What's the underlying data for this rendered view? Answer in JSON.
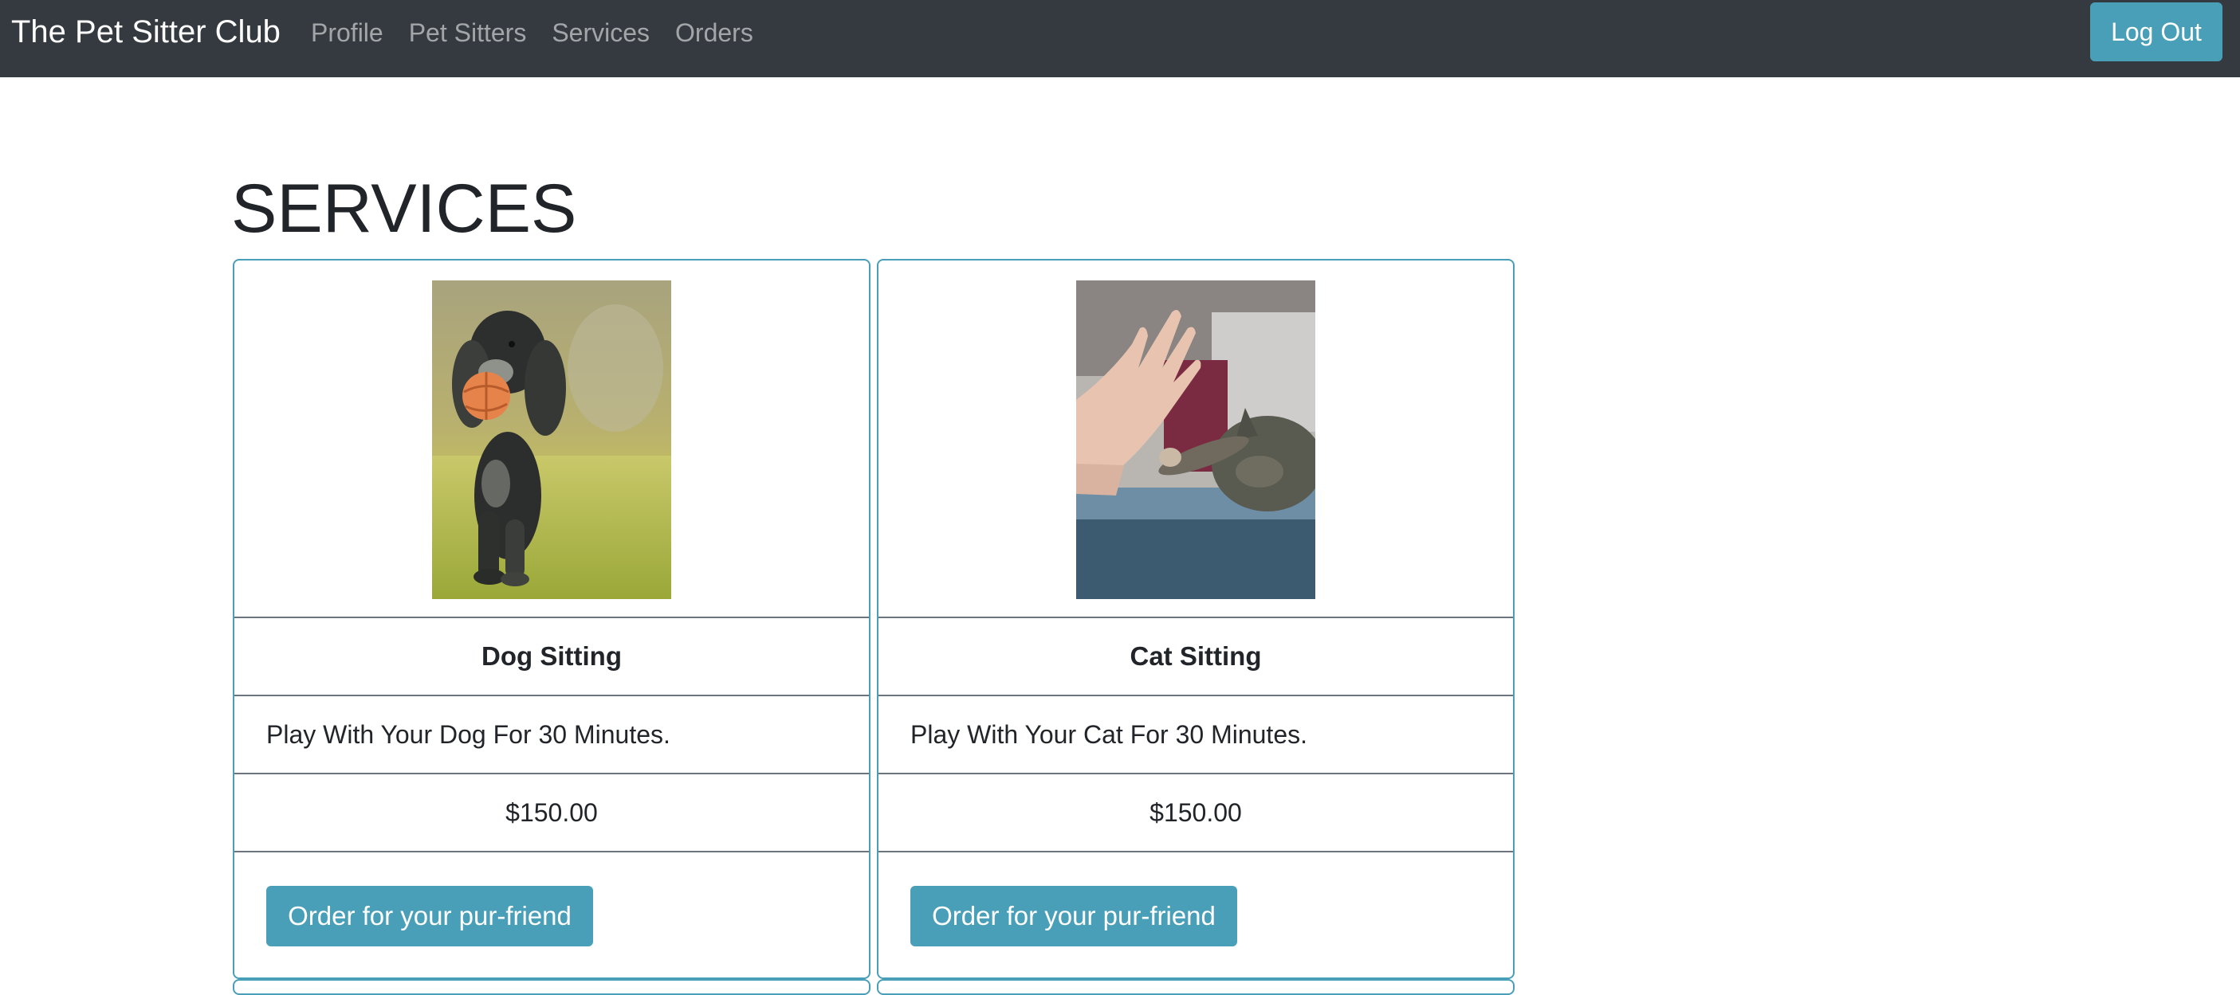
{
  "navbar": {
    "brand": "The Pet Sitter Club",
    "links": [
      "Profile",
      "Pet Sitters",
      "Services",
      "Orders"
    ],
    "logout_label": "Log Out"
  },
  "page": {
    "title": "SERVICES"
  },
  "services": [
    {
      "name": "Dog Sitting",
      "description": "Play With Your Dog For 30 Minutes.",
      "price": "$150.00",
      "order_label": "Order for your pur-friend",
      "image": "dog-with-ball-photo"
    },
    {
      "name": "Cat Sitting",
      "description": "Play With Your Cat For 30 Minutes.",
      "price": "$150.00",
      "order_label": "Order for your pur-friend",
      "image": "cat-high-five-photo"
    }
  ],
  "colors": {
    "navbar_bg": "#343a40",
    "accent": "#4a9fb8",
    "nav_link": "#a0a4a8"
  }
}
